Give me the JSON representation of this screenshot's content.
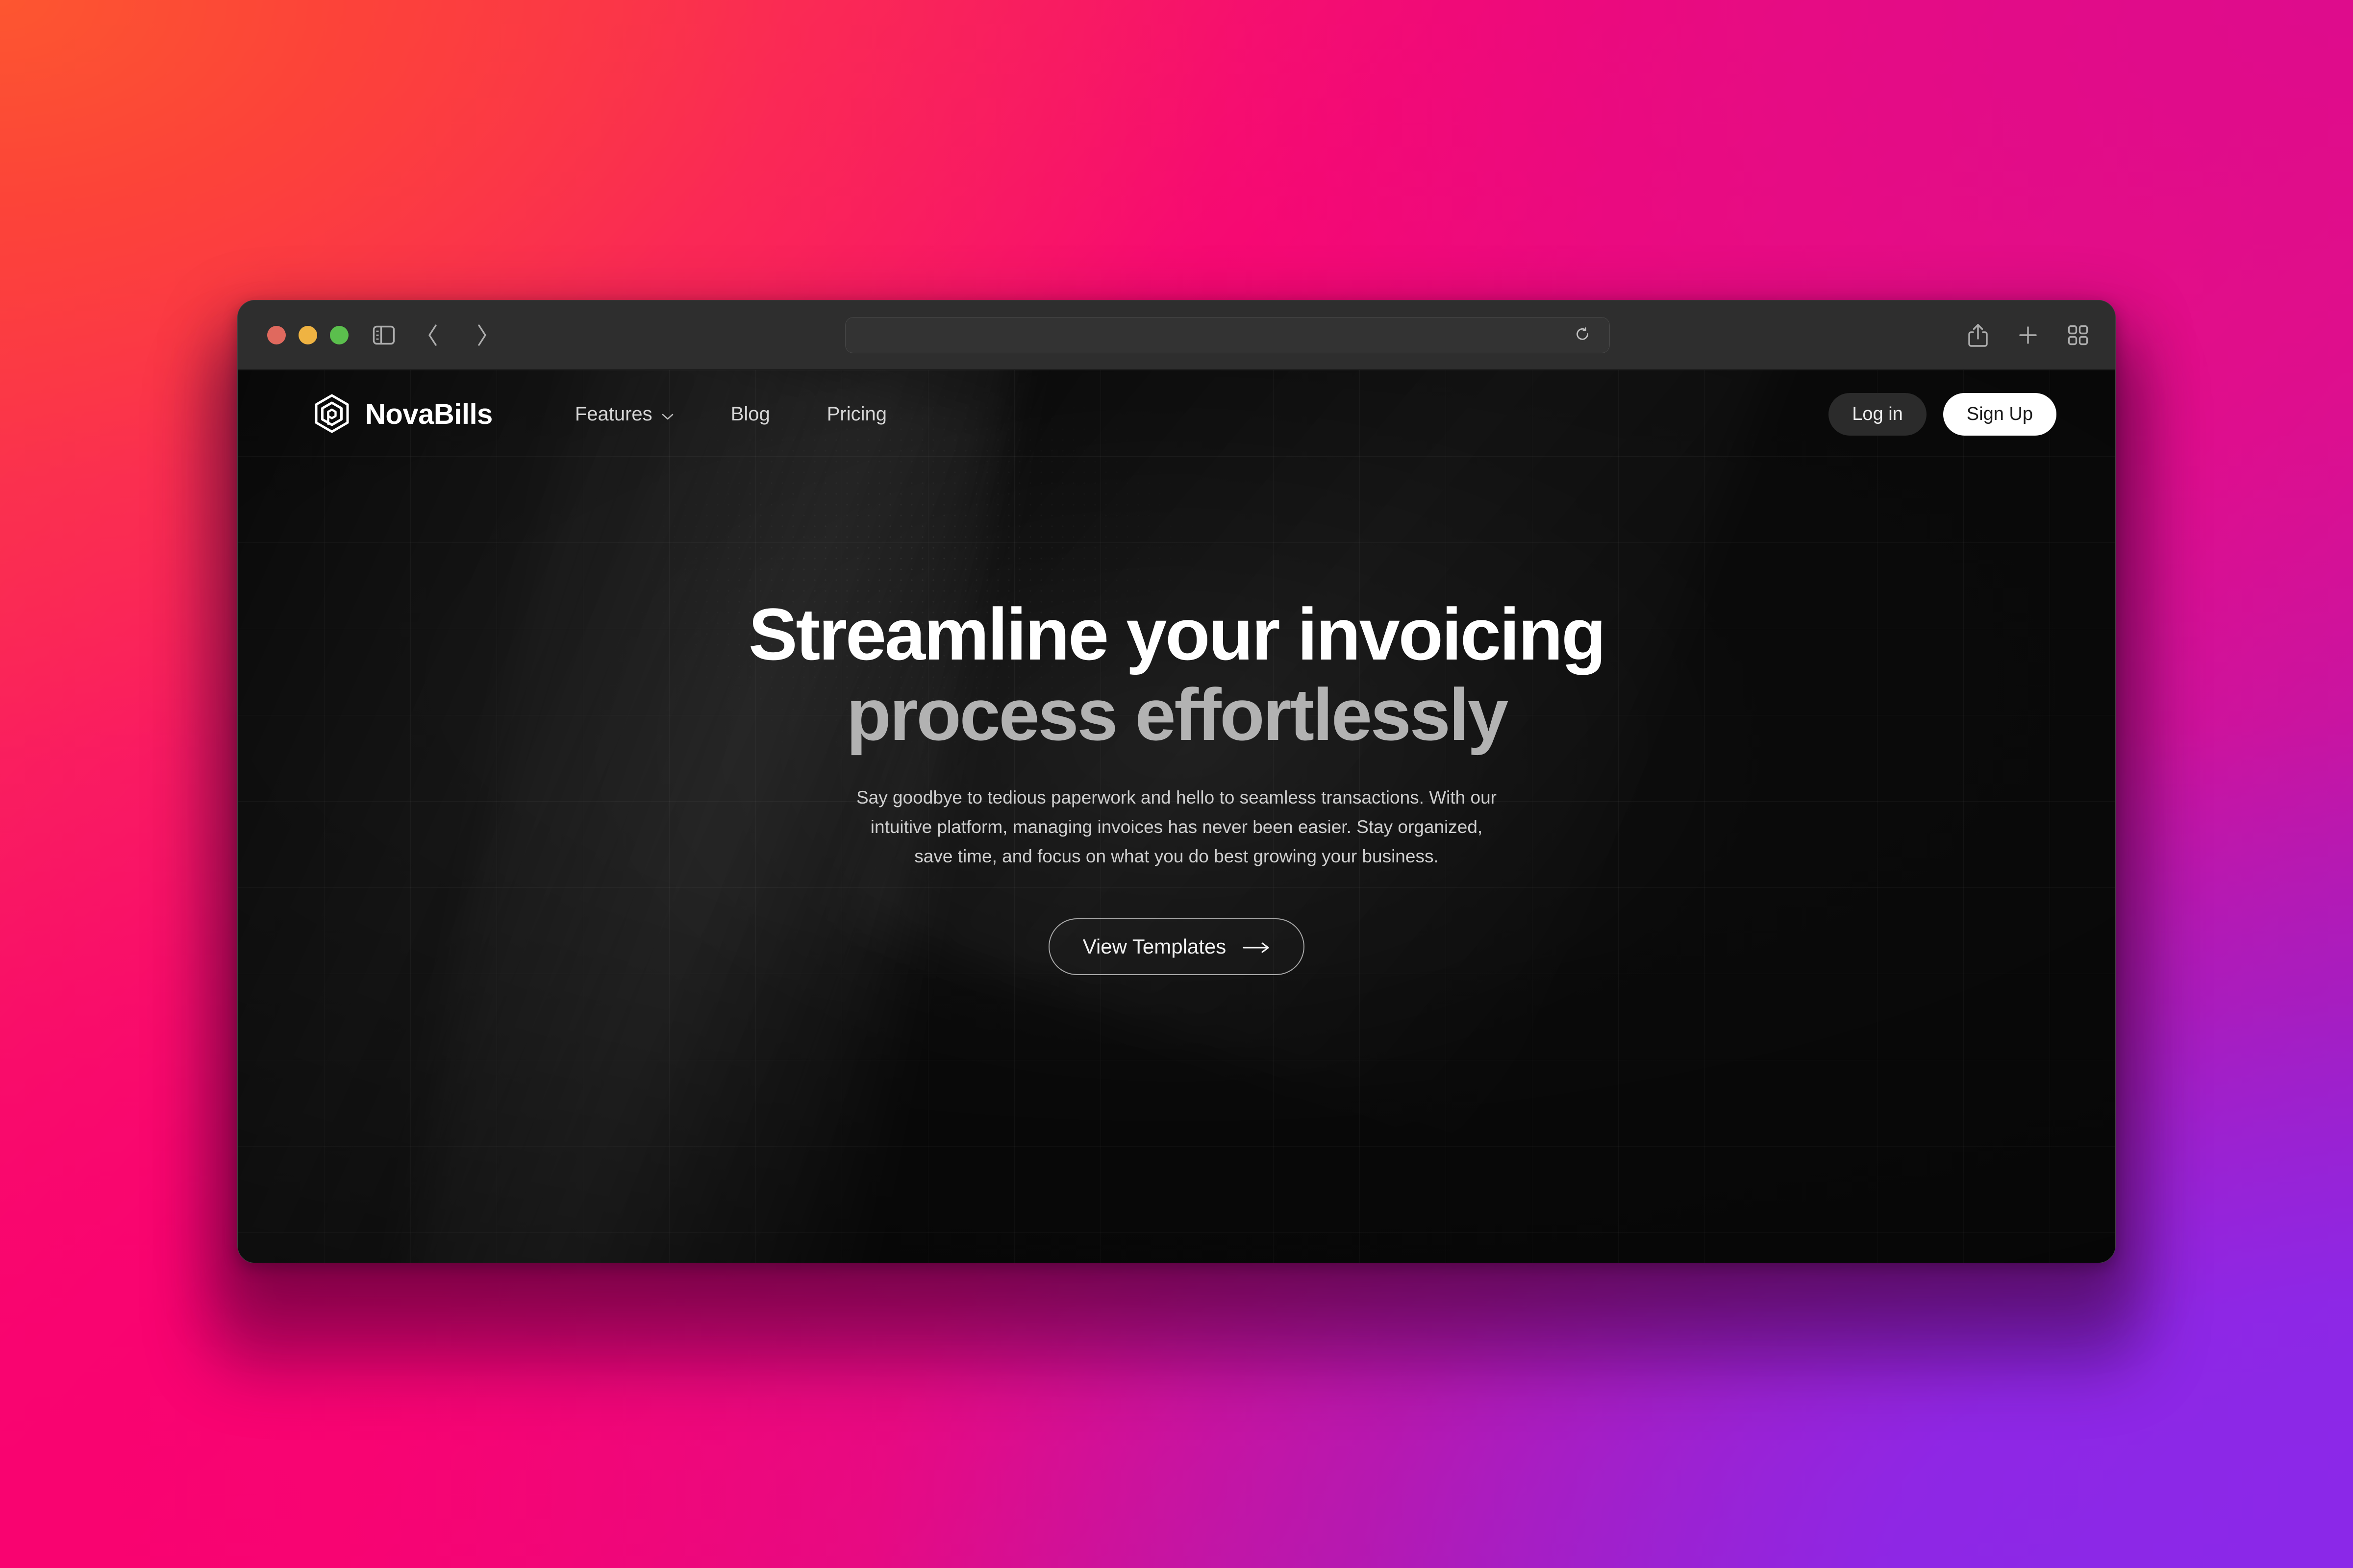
{
  "browser": {
    "traffic_lights": {
      "close": "close",
      "minimize": "minimize",
      "maximize": "maximize",
      "close_color": "#E0695E",
      "minimize_color": "#EFB342",
      "maximize_color": "#5BBF4D"
    },
    "toolbar": {
      "sidebar_toggle": "sidebar-toggle",
      "back": "back",
      "forward": "forward",
      "share": "share",
      "new_tab": "new-tab",
      "tab_overview": "tab-overview",
      "reload": "reload"
    },
    "address_bar": {
      "value": "",
      "placeholder": ""
    }
  },
  "site": {
    "brand": {
      "name": "NovaBills",
      "logo_icon": "hexagon-spiral-icon"
    },
    "nav": [
      {
        "label": "Features",
        "has_dropdown": true
      },
      {
        "label": "Blog",
        "has_dropdown": false
      },
      {
        "label": "Pricing",
        "has_dropdown": false
      }
    ],
    "actions": {
      "login": "Log in",
      "signup": "Sign Up"
    }
  },
  "hero": {
    "title_line1": "Streamline your invoicing",
    "title_line2": "process effortlessly",
    "subtitle": "Say goodbye to tedious paperwork and hello to seamless transactions. With our intuitive platform, managing invoices has never been easier. Stay organized, save time, and focus on what you do best growing your business.",
    "cta_label": "View Templates",
    "cta_icon": "arrow-right-icon"
  },
  "theme": {
    "wallpaper_top_left": "#FC4438",
    "wallpaper_top_right": "#DE0C8C",
    "wallpaper_bottom_left": "#F90370",
    "wallpaper_bottom_right": "#8B28E8",
    "page_background": "#0A0A0A",
    "toolbar_background": "#2E2E2E",
    "title_color": "#FFFFFF",
    "subtitle_color": "#CFCFCF",
    "accent_on_dark": "#B2B2B2"
  }
}
